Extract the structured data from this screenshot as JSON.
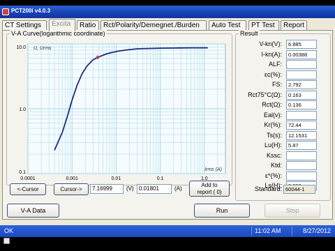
{
  "app": {
    "title": "PCT200i v4.0.3"
  },
  "tabs": [
    {
      "label": "CT Settings",
      "active": false
    },
    {
      "label": "Excita",
      "active": true
    },
    {
      "label": "Ratio",
      "active": false
    },
    {
      "label": "Rct/Polarity/Demegnet./Burden",
      "active": false
    },
    {
      "label": "Auto Test",
      "active": false
    },
    {
      "label": "PT Test",
      "active": false
    },
    {
      "label": "Report",
      "active": false
    }
  ],
  "chart_group": {
    "title": "V-A Curve(logarithmic coordinate)"
  },
  "chart_data": {
    "type": "line",
    "scale": "log-log",
    "ylabel": "U, Urms",
    "xlabel": "Irms (A)",
    "xlim": [
      0.0001,
      3
    ],
    "ylim": [
      0.1,
      10
    ],
    "x_ticks": [
      "0.0001",
      "0.001",
      "0.01",
      "0.1",
      "1.0"
    ],
    "y_ticks": [
      "10.0",
      "1.0",
      "0.1"
    ],
    "grid": true,
    "colors": {
      "curve": "#1a2a7a",
      "marker": "#e04040",
      "plot_bg": "#f6fbff",
      "grid": "#9fd8e0"
    },
    "series": [
      {
        "x": [
          0.0004,
          0.0006,
          0.0008,
          0.001,
          0.0013,
          0.0017,
          0.0022,
          0.003,
          0.004,
          0.006,
          0.008,
          0.012,
          0.018,
          0.03,
          0.05,
          0.1,
          0.2,
          0.5,
          1.0,
          1.2
        ],
        "y": [
          0.23,
          0.43,
          0.8,
          1.35,
          2.3,
          3.5,
          4.6,
          5.7,
          6.3,
          7.0,
          7.4,
          7.8,
          8.1,
          8.4,
          8.5,
          8.6,
          8.65,
          8.7,
          8.7,
          8.7
        ]
      }
    ],
    "knee_marker": {
      "x": 0.0038,
      "y": 6.2
    }
  },
  "cursor": {
    "prev_label": "<-Cursor",
    "next_label": "Cursor->",
    "voltage_value": "7.16999",
    "voltage_unit": "(V)",
    "current_value": "0.01801",
    "current_unit": "(A)",
    "add_label_line1": "Add to",
    "add_label_line2": "report ( 0)"
  },
  "buttons": {
    "va_data": "V-A Data",
    "run": "Run",
    "stop": "Stop"
  },
  "result": {
    "title": "Result",
    "rows": [
      {
        "label": "V-kn(V):",
        "value": "6.885"
      },
      {
        "label": "I-kn(A):",
        "value": "0.00388"
      },
      {
        "label": "ALF:",
        "value": ""
      },
      {
        "label": "εc(%):",
        "value": ""
      },
      {
        "label": "FS:",
        "value": "2.792"
      },
      {
        "label": "Rct75°C(Ω):",
        "value": "0.163"
      },
      {
        "label": "Rct(Ω):",
        "value": "0.136"
      },
      {
        "label": "Eal(v):",
        "value": ""
      },
      {
        "label": "Kr(%):",
        "value": "72.44"
      },
      {
        "label": "Ts(s):",
        "value": "12.1531"
      },
      {
        "label": "Lu(H):",
        "value": "5.87"
      },
      {
        "label": "Kssc:",
        "value": ""
      },
      {
        "label": "Ktd:",
        "value": ""
      },
      {
        "label": "ε*(%):",
        "value": ""
      },
      {
        "label": "Ls(H):",
        "value": "0.099"
      }
    ],
    "standard_label": "Standard:",
    "standard_value": "60044-1"
  },
  "status": {
    "left": "OK",
    "time": "11:02 AM",
    "date": "8/27/2012"
  }
}
